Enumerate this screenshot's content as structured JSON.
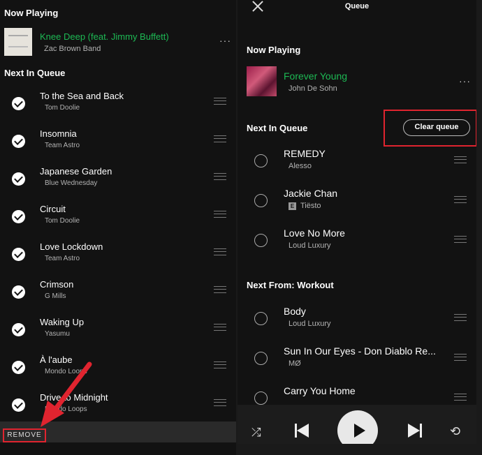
{
  "left": {
    "now_playing_heading": "Now Playing",
    "now_playing": {
      "title": "Knee Deep (feat. Jimmy Buffett)",
      "artist": "Zac Brown Band",
      "more_glyph": "···"
    },
    "queue_heading": "Next In Queue",
    "queue": [
      {
        "title": "To the Sea and Back",
        "artist": "Tom Doolie"
      },
      {
        "title": "Insomnia",
        "artist": "Team Astro"
      },
      {
        "title": "Japanese Garden",
        "artist": "Blue Wednesday"
      },
      {
        "title": "Circuit",
        "artist": "Tom Doolie"
      },
      {
        "title": "Love Lockdown",
        "artist": "Team Astro"
      },
      {
        "title": "Crimson",
        "artist": "G Mills"
      },
      {
        "title": "Waking Up",
        "artist": "Yasumu"
      },
      {
        "title": "À l'aube",
        "artist": "Mondo Loops"
      },
      {
        "title": "Drive to Midnight",
        "artist": "Mondo Loops"
      }
    ],
    "remove_label": "REMOVE"
  },
  "right": {
    "header_title": "Queue",
    "now_playing_heading": "Now Playing",
    "now_playing": {
      "title": "Forever Young",
      "artist": "John De Sohn",
      "more_glyph": "···"
    },
    "queue_heading": "Next In Queue",
    "clear_queue_label": "Clear queue",
    "queue": [
      {
        "title": "REMEDY",
        "artist": "Alesso",
        "explicit": false
      },
      {
        "title": "Jackie Chan",
        "artist": "Tiësto",
        "explicit": true
      },
      {
        "title": "Love No More",
        "artist": "Loud Luxury",
        "explicit": false
      }
    ],
    "next_from_heading": "Next From: Workout",
    "next_from": [
      {
        "title": "Body",
        "artist": "Loud Luxury"
      },
      {
        "title": "Sun In Our Eyes - Don Diablo Re...",
        "artist": "MØ"
      },
      {
        "title": "Carry You Home",
        "artist": ""
      }
    ],
    "explicit_badge": "E"
  },
  "player": {
    "icons": [
      "shuffle-icon",
      "previous-icon",
      "play-icon",
      "next-icon",
      "repeat-icon"
    ]
  },
  "colors": {
    "accent": "#1db954",
    "highlight": "#e0242f",
    "background": "#121212"
  }
}
